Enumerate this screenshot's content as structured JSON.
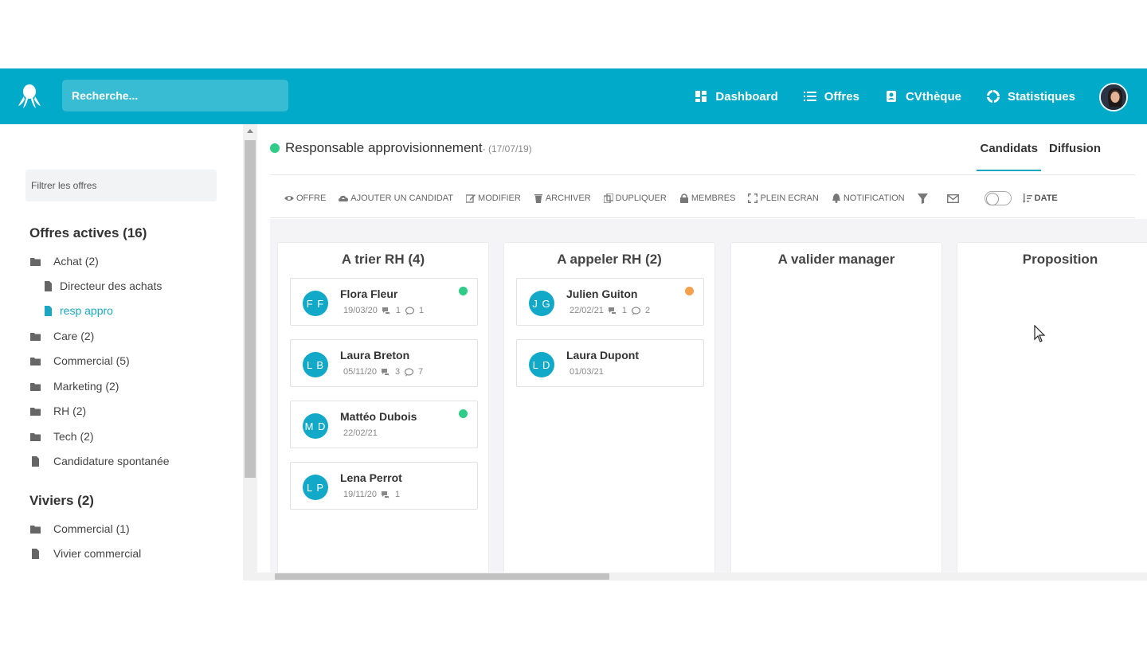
{
  "header": {
    "search_placeholder": "Recherche...",
    "nav": [
      {
        "label": "Dashboard",
        "icon": "dashboard-icon"
      },
      {
        "label": "Offres",
        "icon": "list-icon"
      },
      {
        "label": "CVthèque",
        "icon": "contact-card-icon"
      },
      {
        "label": "Statistiques",
        "icon": "chart-ring-icon"
      }
    ]
  },
  "sidebar": {
    "filter_placeholder": "Filtrer les offres",
    "active_title": "Offres actives (16)",
    "items": [
      {
        "label": "Achat (2)",
        "icon": "folder-icon"
      },
      {
        "label": "Directeur des achats",
        "icon": "file-icon"
      },
      {
        "label": "resp appro",
        "icon": "file-icon"
      },
      {
        "label": "Care (2)",
        "icon": "folder-icon"
      },
      {
        "label": "Commercial (5)",
        "icon": "folder-icon"
      },
      {
        "label": "Marketing (2)",
        "icon": "folder-icon"
      },
      {
        "label": "RH (2)",
        "icon": "folder-icon"
      },
      {
        "label": "Tech (2)",
        "icon": "folder-icon"
      },
      {
        "label": "Candidature spontanée",
        "icon": "file-icon"
      }
    ],
    "viviers_title": "Viviers (2)",
    "viviers": [
      {
        "label": "Commercial (1)",
        "icon": "folder-icon"
      },
      {
        "label": "Vivier commercial",
        "icon": "file-icon"
      }
    ]
  },
  "job": {
    "title": "Responsable approvisionnement",
    "date": "- (17/07/19)",
    "status_color": "#2ecc87",
    "tabs": [
      "Candidats",
      "Diffusion"
    ]
  },
  "toolbar": {
    "items": [
      "OFFRE",
      "AJOUTER UN CANDIDAT",
      "MODIFIER",
      "ARCHIVER",
      "DUPLIQUER",
      "MEMBRES",
      "PLEIN ECRAN",
      "NOTIFICATION"
    ],
    "sort_label": "DATE"
  },
  "columns": [
    {
      "title": "A trier RH (4)",
      "cards": [
        {
          "initials": "F F",
          "name": "Flora Fleur",
          "date": "19/03/20",
          "c1": "1",
          "c2": "1",
          "dot": "#2ecc87"
        },
        {
          "initials": "L B",
          "name": "Laura Breton",
          "date": "05/11/20",
          "c1": "3",
          "c2": "7",
          "dot": ""
        },
        {
          "initials": "M D",
          "name": "Mattéo Dubois",
          "date": "22/02/21",
          "c1": "",
          "c2": "",
          "dot": "#2ecc87"
        },
        {
          "initials": "L P",
          "name": "Lena Perrot",
          "date": "19/11/20",
          "c1": "1",
          "c2": "",
          "dot": ""
        }
      ]
    },
    {
      "title": "A appeler RH (2)",
      "cards": [
        {
          "initials": "J G",
          "name": "Julien Guiton",
          "date": "22/02/21",
          "c1": "1",
          "c2": "2",
          "dot": "#f5a04a"
        },
        {
          "initials": "L D",
          "name": "Laura Dupont",
          "date": "01/03/21",
          "c1": "",
          "c2": "",
          "dot": ""
        }
      ]
    },
    {
      "title": "A valider manager",
      "cards": []
    },
    {
      "title": "Proposition",
      "cards": []
    }
  ]
}
